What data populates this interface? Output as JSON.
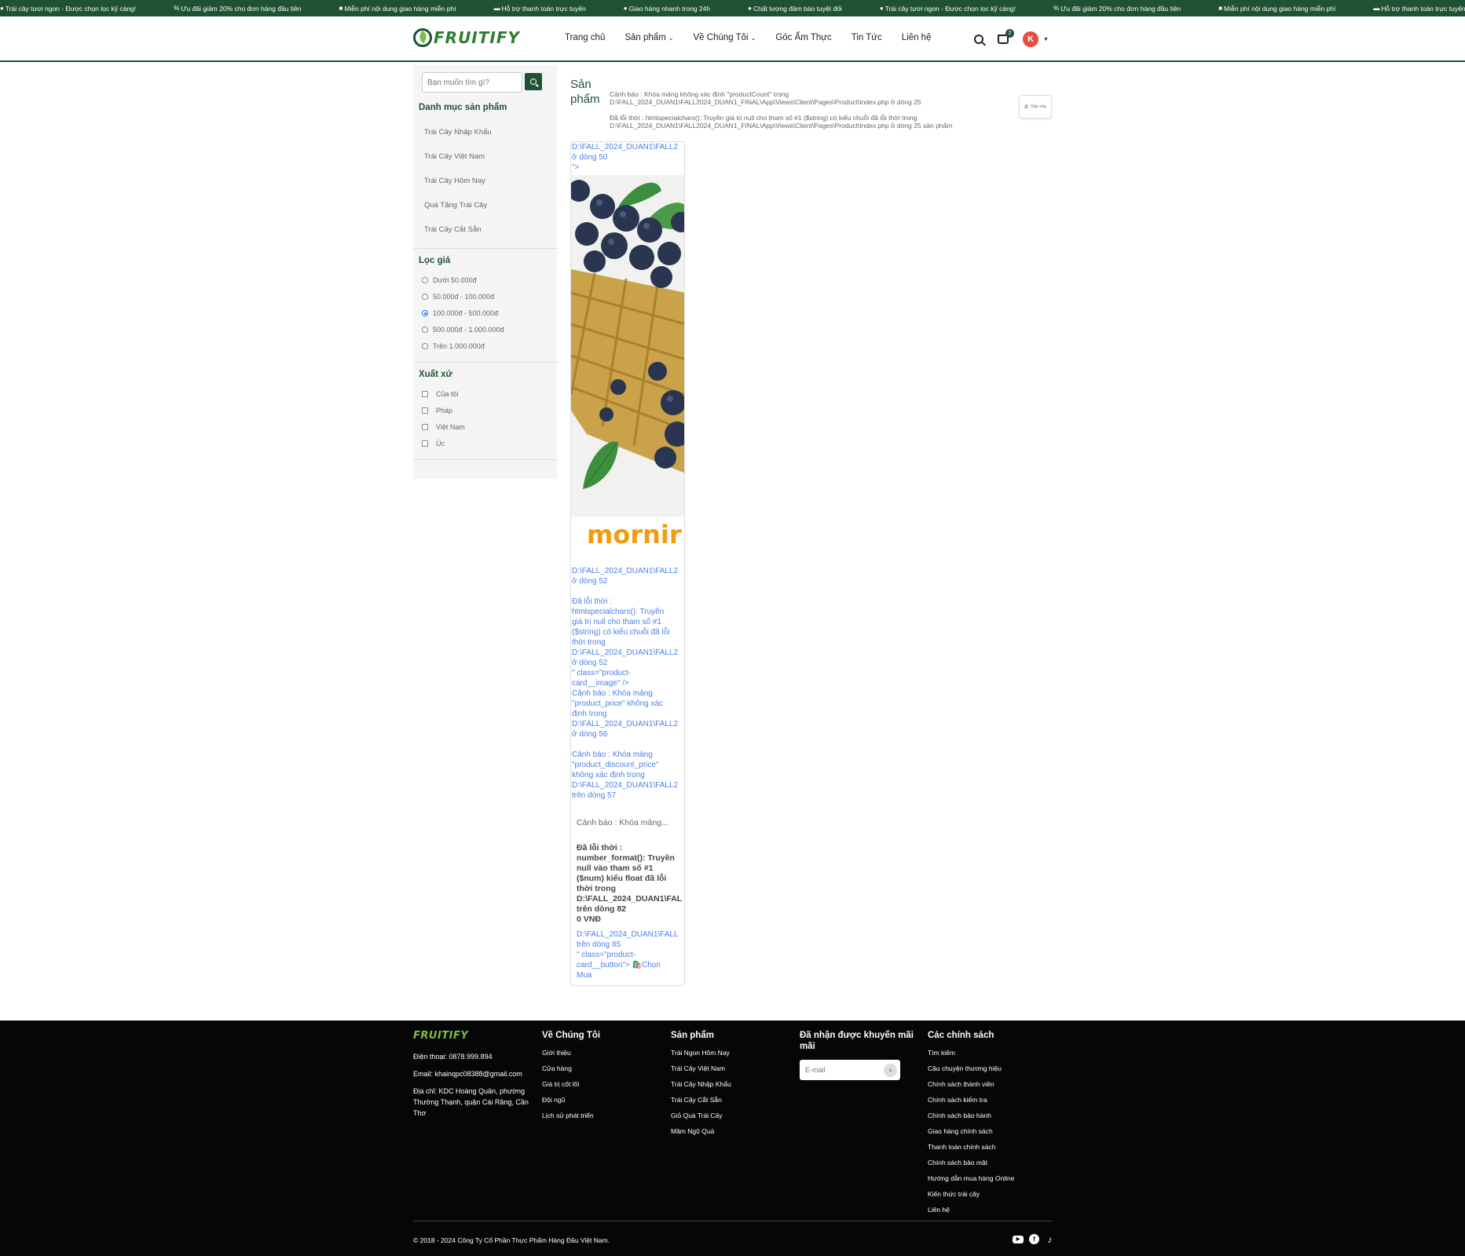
{
  "topbar": {
    "items": [
      {
        "icon": "apple-icon",
        "glyph": "●",
        "text": "Trái cây tươi ngon - Được chọn lọc kỹ càng!"
      },
      {
        "icon": "percent-icon",
        "glyph": "%",
        "text": "Ưu đãi giảm 20% cho đơn hàng đầu tiên"
      },
      {
        "icon": "truck-icon",
        "glyph": "■",
        "text": "Miễn phí nội dung giao hàng miễn phí"
      },
      {
        "icon": "card-icon",
        "glyph": "▬",
        "text": "Hỗ trợ thanh toán trực tuyến"
      },
      {
        "icon": "clock-icon",
        "glyph": "●",
        "text": "Giao hàng nhanh trong 24h"
      },
      {
        "icon": "check-icon",
        "glyph": "●",
        "text": "Chất lượng đảm bảo tuyệt đối"
      },
      {
        "icon": "apple-icon",
        "glyph": "●",
        "text": "Trái cây tươi ngon - Được chọn lọc kỹ càng!"
      },
      {
        "icon": "percent-icon",
        "glyph": "%",
        "text": "Ưu đãi giảm 20% cho đơn hàng đầu tiên"
      },
      {
        "icon": "truck-icon",
        "glyph": "■",
        "text": "Miễn phí nội dung giao hàng miễn phí"
      },
      {
        "icon": "card-icon",
        "glyph": "▬",
        "text": "Hỗ trợ thanh toán trực tuyến"
      }
    ]
  },
  "header": {
    "logo_text": "FRUITIFY",
    "nav": [
      {
        "label": "Trang chủ",
        "dropdown": false
      },
      {
        "label": "Sản phẩm",
        "dropdown": true
      },
      {
        "label": "Về Chúng Tôi",
        "dropdown": true
      },
      {
        "label": "Góc Ẩm Thực",
        "dropdown": false
      },
      {
        "label": "Tin Tức",
        "dropdown": false
      },
      {
        "label": "Liên hệ",
        "dropdown": false
      }
    ],
    "cart_count": "2",
    "avatar_initial": "K"
  },
  "sidebar": {
    "search_placeholder": "Bạn muốn tìm gì?",
    "categories_title": "Danh mục sản phẩm",
    "categories": [
      "Trái Cây Nhập Khẩu",
      "Trái Cây Việt Nam",
      "Trái Cây Hôm Nay",
      "Quà Tặng Trái Cây",
      "Trái Cây Cắt Sẵn"
    ],
    "price_title": "Lọc giá",
    "price_options": [
      {
        "label": "Dưới 50.000đ",
        "checked": false
      },
      {
        "label": "50.000đ - 100.000đ",
        "checked": false
      },
      {
        "label": "100.000đ - 500.000đ",
        "checked": true
      },
      {
        "label": "500.000đ - 1.000.000đ",
        "checked": false
      },
      {
        "label": "Trên 1.000.000đ",
        "checked": false
      }
    ],
    "origin_title": "Xuất xứ",
    "origin_options": [
      "Của tôi",
      "Pháp",
      "Việt Nam",
      "Úc"
    ]
  },
  "main": {
    "title": "Sản phẩm",
    "warning_1": "Cảnh báo : Khóa mảng không xác định \"productCount\" trong D:\\FALL_2024_DUAN1\\FALL2024_DUAN1_FINAL\\App\\Views\\Client\\Pages\\Product\\Index.php ở dòng 25",
    "warning_2": "Đã lỗi thời : htmlspecialchars(): Truyền giá trị null cho tham số #1 ($string) có kiểu chuỗi đã lỗi thời trong D:\\FALL_2024_DUAN1\\FALL2024_DUAN1_FINAL\\App\\Views\\Client\\Pages\\Product\\Index.php ở dòng 25 sản phẩm",
    "sort_label": "Sắp xếp"
  },
  "product_card": {
    "top_link": "D:\\FALL_2024_DUAN1\\FALL2\nở dòng 50\n\">",
    "image_alt": "blueberries-in-basket",
    "brand_logo": "mornir",
    "errors": "D:\\FALL_2024_DUAN1\\FALL2\nở dòng 52\n\nĐã lỗi thời :\nhtmlspecialchars(): Truyền\ngiá trị null cho tham số #1\n($string) có kiểu chuỗi đã lỗi\nthời trong\nD:\\FALL_2024_DUAN1\\FALL2\nở dòng 52\n\" class=\"product-\ncard__image\" />\nCảnh báo : Khóa mảng\n\"product_price\" không xác\nđịnh trong\nD:\\FALL_2024_DUAN1\\FALL2\nở dòng 56\n\nCảnh báo : Khóa mảng\n\"product_discount_price\"\nkhông xác định trong\nD:\\FALL_2024_DUAN1\\FALL2\ntrên dòng 57",
    "warning_short": "Cảnh báo : Khóa mảng...",
    "price_error": "Đã lỗi thời :\nnumber_format(): Truyền\nnull vào tham số #1\n($num) kiểu float đã lỗi\nthời trong\nD:\\FALL_2024_DUAN1\\FAL\ntrên dòng 82\n0 VNĐ",
    "button_text": "D:\\FALL_2024_DUAN1\\FALL\ntrên dòng 85\n\" class=\"product-\ncard__button\"> 🛍️Chọn\nMua"
  },
  "footer": {
    "logo_text": "FRUITIFY",
    "phone": "Điện thoại: 0878.999.894",
    "email": "Email: khainqpc08388@gmail.com",
    "address": "Địa chỉ: KDC Hoàng Quân, phường Thường Thạnh, quận Cái Răng, Cần Thơ",
    "about_title": "Về Chúng Tôi",
    "about_links": [
      "Giới thiệu",
      "Cửa hàng",
      "Giá trị cốt lõi",
      "Đội ngũ",
      "Lịch sử phát triển"
    ],
    "products_title": "Sản phẩm",
    "product_links": [
      "Trái Ngon Hôm Nay",
      "Trái Cây Việt Nam",
      "Trái Cây Nhập Khẩu",
      "Trái Cây Cắt Sẵn",
      "Giỏ Quà Trái Cây",
      "Mâm Ngũ Quả"
    ],
    "promo_title": "Đã nhận được khuyến mãi mãi",
    "email_placeholder": "E-mail",
    "policy_title": "Các chính sách",
    "policy_links": [
      "Tìm kiếm",
      "Câu chuyện thương hiệu",
      "Chính sách thành viên",
      "Chính sách kiểm tra",
      "Chính sách bảo hành",
      "Giao hàng chính sách",
      "Thanh toán chính sách",
      "Chính sách bảo mật",
      "Hướng dẫn mua hàng Online",
      "Kiến thức trái cây",
      "Liên hệ"
    ],
    "copyright": "© 2018 - 2024 Công Ty Cổ Phần Thực Phẩm Hàng Đầu Việt Nam.",
    "socials": [
      "youtube-icon",
      "facebook-icon",
      "tiktok-icon"
    ]
  },
  "colors": {
    "brand_green": "#1f5233",
    "accent_green": "#7cbf3a",
    "link_blue": "#4a7fe8",
    "avatar_red": "#e74c3c"
  }
}
